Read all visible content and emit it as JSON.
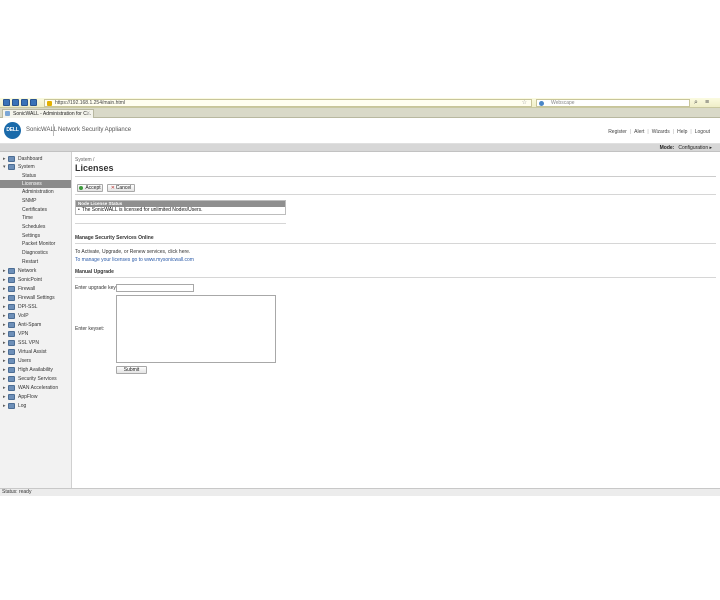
{
  "browser": {
    "url": "https://192.168.1.254/main.html",
    "search_placeholder": "Webscape",
    "tab_title": "SonicWALL - Administration for C..."
  },
  "header": {
    "logo_text": "DELL",
    "brand": "SonicWALL",
    "brand_sub": "Network Security Appliance",
    "links": [
      "Register",
      "Alert",
      "Wizards",
      "Help",
      "Logout"
    ]
  },
  "mode_bar": {
    "label": "Mode:",
    "value": "Configuration ▸"
  },
  "sidebar": {
    "top_items": [
      {
        "label": "Dashboard",
        "arrow": "▸"
      },
      {
        "label": "System",
        "arrow": "▾"
      }
    ],
    "system_sub": [
      "Status",
      "Licenses",
      "Administration",
      "SNMP",
      "Certificates",
      "Time",
      "Schedules",
      "Settings",
      "Packet Monitor",
      "Diagnostics",
      "Restart"
    ],
    "items": [
      {
        "label": "Network",
        "arrow": "▸"
      },
      {
        "label": "SonicPoint",
        "arrow": "▸"
      },
      {
        "label": "Firewall",
        "arrow": "▸"
      },
      {
        "label": "Firewall Settings",
        "arrow": "▸"
      },
      {
        "label": "DPI-SSL",
        "arrow": "▸"
      },
      {
        "label": "VoIP",
        "arrow": "▸"
      },
      {
        "label": "Anti-Spam",
        "arrow": "▸"
      },
      {
        "label": "VPN",
        "arrow": "▸"
      },
      {
        "label": "SSL VPN",
        "arrow": "▸"
      },
      {
        "label": "Virtual Assist",
        "arrow": "▸"
      },
      {
        "label": "Users",
        "arrow": "▸"
      },
      {
        "label": "High Availability",
        "arrow": "▸"
      },
      {
        "label": "Security Services",
        "arrow": "▸"
      },
      {
        "label": "WAN Acceleration",
        "arrow": "▸"
      },
      {
        "label": "AppFlow",
        "arrow": "▸"
      },
      {
        "label": "Log",
        "arrow": "▸"
      }
    ]
  },
  "main": {
    "breadcrumb": "System /",
    "title": "Licenses",
    "accept_label": "Accept",
    "cancel_label": "Cancel",
    "node_status_header": "Node License Status",
    "node_status_text": "The SonicWALL is licensed for unlimited Nodes/Users.",
    "manage_title": "Manage Security Services Online",
    "manage_line1": "To Activate, Upgrade, or Renew services, click here.",
    "manage_line2": "To manage your licenses go to www.mysonicwall.com",
    "manual_title": "Manual Upgrade",
    "upgrade_key_label": "Enter upgrade key:",
    "keyset_label": "Enter keyset:",
    "submit_label": "Submit"
  },
  "statusbar": {
    "text": "Status: ready"
  }
}
